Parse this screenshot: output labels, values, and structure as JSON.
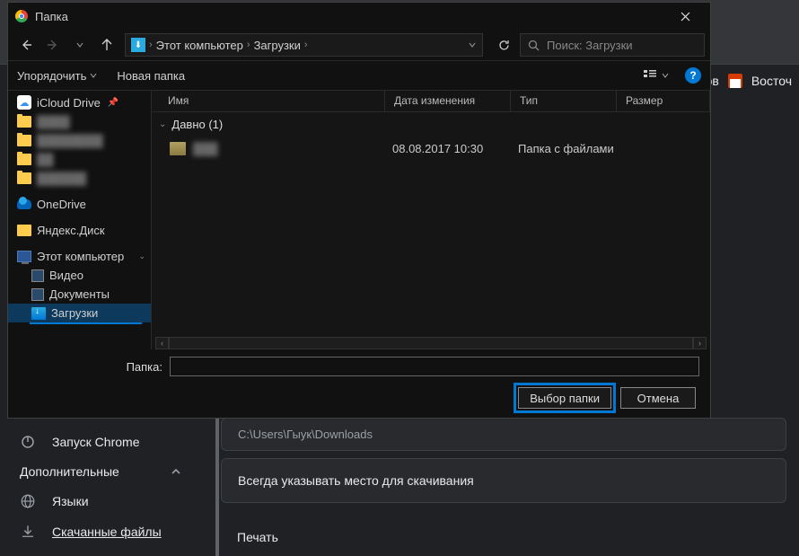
{
  "dialog": {
    "title": "Папка",
    "breadcrumbs": [
      "Этот компьютер",
      "Загрузки"
    ],
    "search_placeholder": "Поиск: Загрузки",
    "toolbar": {
      "organize": "Упорядочить",
      "new_folder": "Новая папка"
    },
    "tree": {
      "icloud": "iCloud Drive",
      "onedrive": "OneDrive",
      "yadisk": "Яндекс.Диск",
      "this_pc": "Этот компьютер",
      "video": "Видео",
      "documents": "Документы",
      "downloads": "Загрузки"
    },
    "columns": {
      "name": "Имя",
      "date": "Дата изменения",
      "type": "Тип",
      "size": "Размер"
    },
    "group_label": "Давно (1)",
    "files": [
      {
        "date": "08.08.2017 10:30",
        "type": "Папка с файлами"
      }
    ],
    "folder_label": "Папка:",
    "folder_value": "",
    "select_btn": "Выбор папки",
    "cancel_btn": "Отмена"
  },
  "chrome": {
    "topbar_right1": "ков",
    "topbar_right2": "Восточ",
    "launch": "Запуск Chrome",
    "additional": "Дополнительные",
    "languages": "Языки",
    "downloaded_files": "Скачанные файлы",
    "path": "C:\\Users\\Гыук\\Downloads",
    "always_ask": "Всегда указывать место для скачивания",
    "print": "Печать"
  }
}
